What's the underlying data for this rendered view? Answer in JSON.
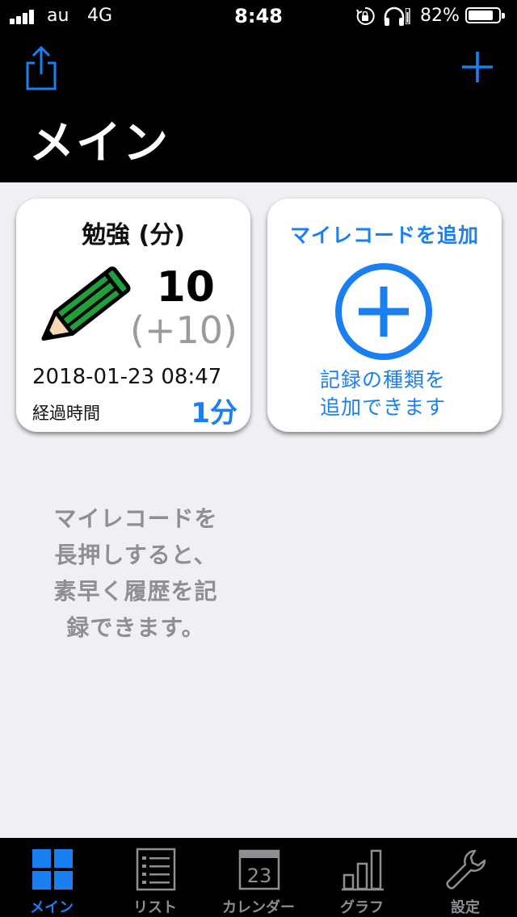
{
  "status_bar": {
    "carrier": "au",
    "network": "4G",
    "time": "8:48",
    "battery": "82%",
    "battery_level": 0.82
  },
  "nav": {
    "title": "メイン",
    "share_icon": "share-icon",
    "add_icon": "plus-icon"
  },
  "record_card": {
    "title": "勉強 (分)",
    "icon": "pencil-icon",
    "value": "10",
    "delta": "(+10)",
    "datetime": "2018-01-23 08:47",
    "elapsed_label": "経過時間",
    "elapsed_value": "1分"
  },
  "add_card": {
    "title": "マイレコードを追加",
    "icon": "plus-circle-icon",
    "description_line1": "記録の種類を",
    "description_line2": "追加できます"
  },
  "hint": {
    "line1": "マイレコードを",
    "line2": "長押しすると、",
    "line3": "素早く履歴を記",
    "line4": "録できます。"
  },
  "tabs": [
    {
      "label": "メイン",
      "icon": "grid-icon",
      "active": true
    },
    {
      "label": "リスト",
      "icon": "list-icon",
      "active": false
    },
    {
      "label": "カレンダー",
      "icon": "calendar-icon",
      "active": false,
      "calendar_day": "23"
    },
    {
      "label": "グラフ",
      "icon": "bar-chart-icon",
      "active": false
    },
    {
      "label": "設定",
      "icon": "wrench-icon",
      "active": false
    }
  ],
  "colors": {
    "accent": "#1a7ff0",
    "background": "#efeff4",
    "bar": "#000000",
    "muted": "#8e8e93",
    "pencil_green": "#1fa03a"
  }
}
